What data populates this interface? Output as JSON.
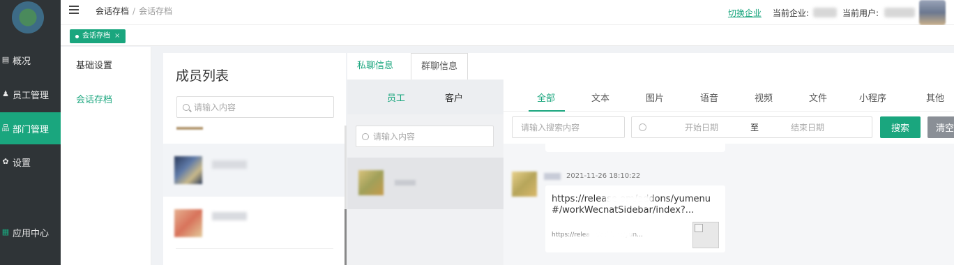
{
  "sidebar": {
    "items": [
      {
        "icon": "overview-icon",
        "glyph": "▤",
        "label": "概况"
      },
      {
        "icon": "user-icon",
        "glyph": "♟",
        "label": "员工管理"
      },
      {
        "icon": "org-icon",
        "glyph": "品",
        "label": "部门管理"
      },
      {
        "icon": "gear-icon",
        "glyph": "✿",
        "label": "设置"
      },
      {
        "icon": "apps-icon",
        "glyph": "▦",
        "label": "应用中心"
      }
    ]
  },
  "header": {
    "breadcrumb_parent": "会话存档",
    "breadcrumb_sep": "/",
    "breadcrumb_current": "会话存档",
    "switch_link": "切换企业",
    "current_company_label": "当前企业:",
    "current_user_label": "当前用户:"
  },
  "tagbar": {
    "tag_label": "会话存档",
    "tag_close": "×"
  },
  "submenu": {
    "items": [
      "基础设置",
      "会话存档"
    ]
  },
  "members": {
    "title": "成员列表",
    "search_placeholder": "请输入内容"
  },
  "chat": {
    "top_tabs": [
      "私聊信息",
      "群聊信息"
    ],
    "ec_tabs": [
      "员工",
      "客户"
    ],
    "ec_search_placeholder": "请输入内容",
    "type_tabs": [
      "全部",
      "文本",
      "图片",
      "语音",
      "视频",
      "文件",
      "小程序",
      "其他"
    ],
    "keyword_placeholder": "请输入搜索内容",
    "start_date_placeholder": "开始日期",
    "date_sep": "至",
    "end_date_placeholder": "结束日期",
    "search_button": "搜索",
    "clear_button": "清空",
    "message": {
      "time": "2021-11-26 18:10:22",
      "title": "https://release                    om/addons/yumenu#/workWecnatSidebar/index?...",
      "url": "https://relea                    m/addons/yun..."
    }
  },
  "colors": {
    "accent": "#1aa67e",
    "sidebar_bg": "#2f3437"
  }
}
